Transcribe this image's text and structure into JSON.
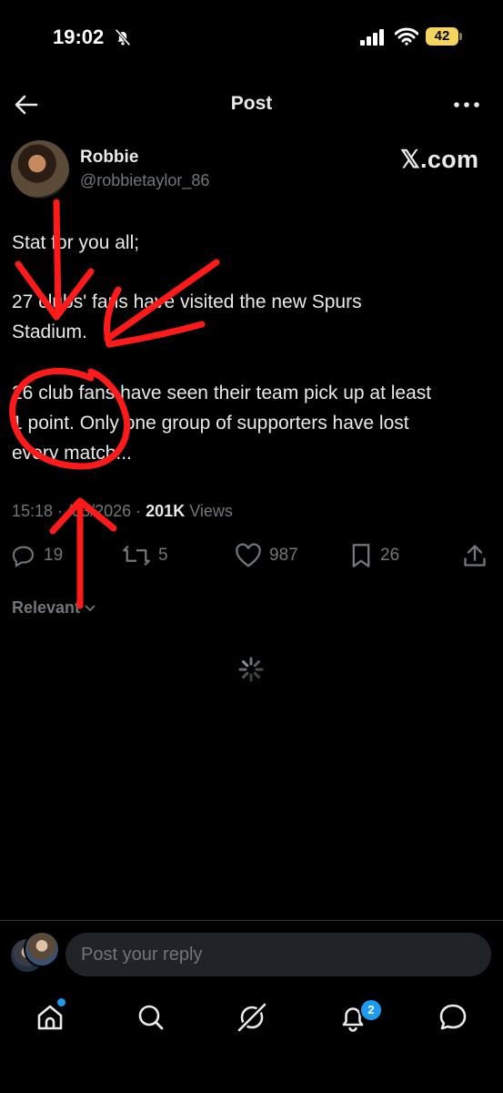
{
  "status": {
    "time": "19:02",
    "battery": "42"
  },
  "header": {
    "title": "Post"
  },
  "author": {
    "name": "Robbie",
    "handle": "@robbietaylor_86",
    "source": "𝕏.com"
  },
  "post": {
    "lines": [
      "Stat for you all;",
      "27 clubs' fans have visited the new Spurs",
      "Stadium.",
      "26 club fans have seen their team pick up at least",
      "1 point. Only one group of supporters have lost",
      "every match..."
    ],
    "time": "15:18",
    "date": "/03/2026",
    "views": "201K",
    "views_label": "Views"
  },
  "actions": {
    "replies": "19",
    "reposts": "5",
    "likes": "987",
    "bookmarks": "26"
  },
  "sort": {
    "label": "Relevant"
  },
  "reply": {
    "placeholder": "Post your reply"
  },
  "nav": {
    "notifications_count": "2"
  },
  "colors": {
    "background": "#000000",
    "text": "#e7e9ea",
    "muted": "#71767b",
    "accent": "#1d9bf0",
    "annotation": "#ff0000"
  }
}
